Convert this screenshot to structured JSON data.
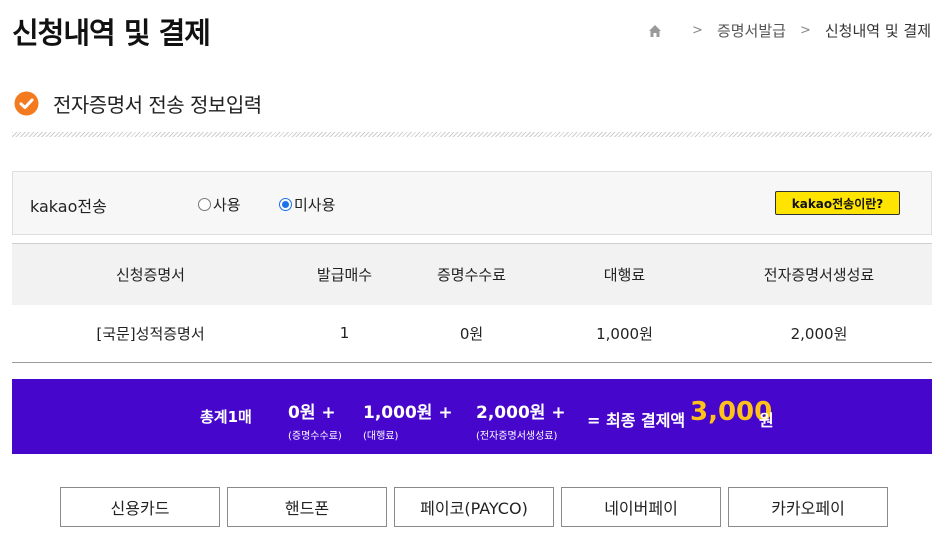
{
  "header": {
    "title": "신청내역 및 결제",
    "breadcrumb": {
      "home_icon": "home-icon",
      "items": [
        "증명서발급",
        "신청내역 및 결제"
      ]
    }
  },
  "section": {
    "icon": "check-circle-icon",
    "title": "전자증명서 전송 정보입력",
    "accent_color": "#f47a20"
  },
  "kakao": {
    "label": "kakao전송",
    "options": [
      {
        "label": "사용",
        "checked": false
      },
      {
        "label": "미사용",
        "checked": true
      }
    ],
    "info_button": "kakao전송이란?",
    "button_color": "#ffe400"
  },
  "table": {
    "headers": [
      "신청증명서",
      "발급매수",
      "증명수수료",
      "대행료",
      "전자증명서생성료"
    ],
    "rows": [
      [
        "[국문]성적증명서",
        "1",
        "0원",
        "1,000원",
        "2,000원"
      ]
    ]
  },
  "summary": {
    "count": "총계1매",
    "items": [
      {
        "amount": "0원  +",
        "caption": "(증명수수료)"
      },
      {
        "amount": "1,000원  +",
        "caption": "(대행료)"
      },
      {
        "amount": "2,000원  +",
        "caption": "(전자증명서생성료)"
      }
    ],
    "final_label": "= 최종 결제액",
    "final_amount": "3,000",
    "currency": "원",
    "bar_color": "#4606cb",
    "highlight_color": "#ffc21a"
  },
  "payment_methods": [
    "신용카드",
    "핸드폰",
    "페이코(PAYCO)",
    "네이버페이",
    "카카오페이"
  ]
}
